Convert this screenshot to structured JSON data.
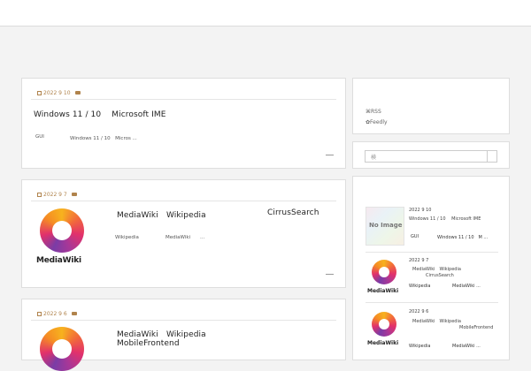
{
  "colors": {
    "accent": "#b0834c",
    "card_bg": "#ffffff",
    "page_bg": "#f3f3f3"
  },
  "posts": [
    {
      "date": "2022 9 10",
      "title": "Windows 11 / 10　 Microsoft IME",
      "category": "GUI",
      "excerpt": "Windows 11 / 10　Micros ..."
    },
    {
      "date": "2022 9 7",
      "title_a": "MediaWiki　Wikipedia",
      "title_b": "CirrusSearch",
      "category": "Wikipedia",
      "excerpt_a": "MediaWiki",
      "excerpt_b": "...",
      "logo_text": "MediaWiki"
    },
    {
      "date": "2022 9 6",
      "title_a": "MediaWiki　Wikipedia",
      "title_b": "MobileFrontend"
    }
  ],
  "sidebar": {
    "rss_label": "RSS",
    "feedly_label": "Feedly",
    "search_placeholder": "検",
    "recent": [
      {
        "date": "2022 9 10",
        "title": "Windows 11 / 10　 Microsoft IME",
        "category": "GUI",
        "excerpt": "Windows 11 / 10　M ...",
        "noimage": "No Image"
      },
      {
        "date": "2022 9 7",
        "title_a": "MediaWiki　Wikipedia",
        "title_b": "CirrusSearch",
        "category": "Wikipedia",
        "excerpt": "MediaWiki ...",
        "logo_text": "MediaWiki"
      },
      {
        "date": "2022 9 6",
        "title_a": "MediaWiki　Wikipedia",
        "title_b": "MobileFrontend",
        "category": "Wikipedia",
        "excerpt": "MediaWiki ...",
        "logo_text": "MediaWiki"
      }
    ]
  }
}
